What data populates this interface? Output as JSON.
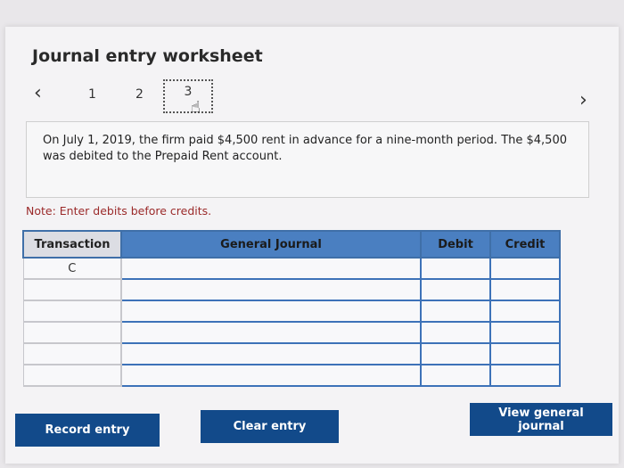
{
  "worksheet": {
    "title": "Journal entry worksheet",
    "nav": {
      "prev_icon": "‹",
      "next_icon": "›",
      "pages": [
        "1",
        "2",
        "3"
      ]
    },
    "description": "On July 1, 2019, the firm paid $4,500 rent in advance for a nine-month period. The $4,500 was debited to the Prepaid Rent account.",
    "note": "Note: Enter debits before credits."
  },
  "table": {
    "headers": {
      "transaction": "Transaction",
      "general_journal": "General Journal",
      "debit": "Debit",
      "credit": "Credit"
    },
    "rows": [
      {
        "transaction": "C",
        "account": "",
        "debit": "",
        "credit": ""
      },
      {
        "transaction": "",
        "account": "",
        "debit": "",
        "credit": ""
      },
      {
        "transaction": "",
        "account": "",
        "debit": "",
        "credit": ""
      },
      {
        "transaction": "",
        "account": "",
        "debit": "",
        "credit": ""
      },
      {
        "transaction": "",
        "account": "",
        "debit": "",
        "credit": ""
      },
      {
        "transaction": "",
        "account": "",
        "debit": "",
        "credit": ""
      }
    ]
  },
  "buttons": {
    "record": "Record entry",
    "clear": "Clear entry",
    "view": "View general journal"
  }
}
